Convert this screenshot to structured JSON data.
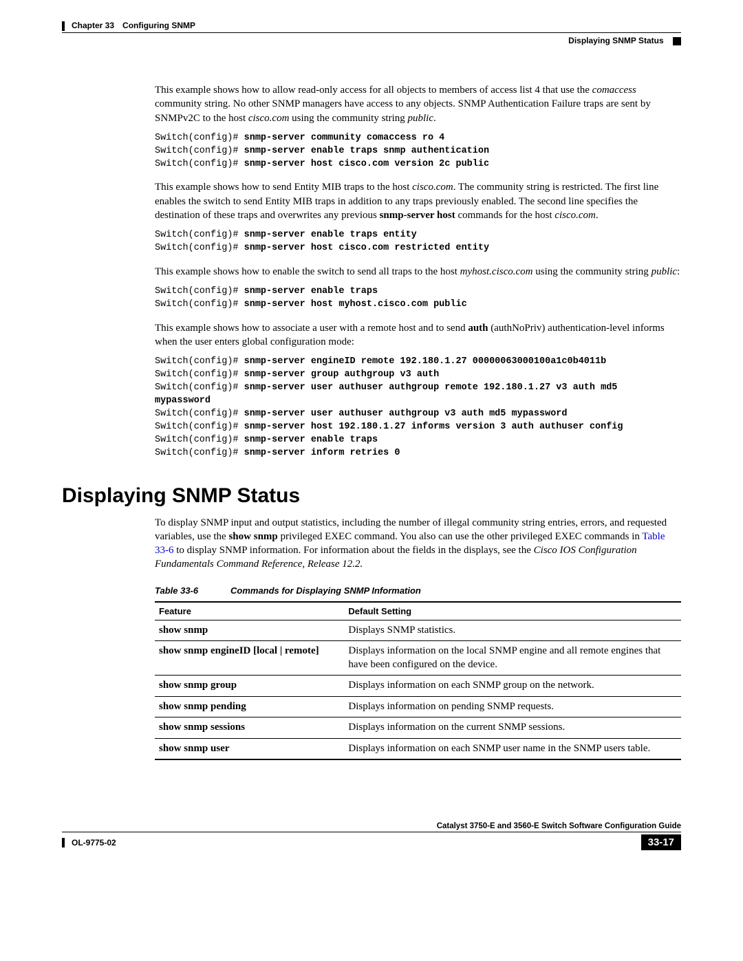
{
  "header": {
    "chapter_label": "Chapter 33",
    "chapter_title": "Configuring SNMP",
    "section_title": "Displaying SNMP Status"
  },
  "p1": {
    "t1": "This example shows how to allow read-only access for all objects to members of access list 4 that use the ",
    "i1": "comaccess",
    "t2": " community string. No other SNMP managers have access to any objects. SNMP Authentication Failure traps are sent by SNMPv2C to the host ",
    "i2": "cisco.com",
    "t3": " using the community string ",
    "i3": "public",
    "t4": "."
  },
  "code1": [
    {
      "prompt": "Switch(config)# ",
      "cmd": "snmp-server community comaccess ro 4"
    },
    {
      "prompt": "Switch(config)# ",
      "cmd": "snmp-server enable traps snmp authentication"
    },
    {
      "prompt": "Switch(config)# ",
      "cmd": "snmp-server host cisco.com version 2c public"
    }
  ],
  "p2": {
    "t1": "This example shows how to send Entity MIB traps to the host ",
    "i1": "cisco.com",
    "t2": ". The community string is restricted. The first line enables the switch to send Entity MIB traps in addition to any traps previously enabled. The second line specifies the destination of these traps and overwrites any previous ",
    "b1": "snmp-server host",
    "t3": " commands for the host ",
    "i2": "cisco.com",
    "t4": "."
  },
  "code2": [
    {
      "prompt": "Switch(config)# ",
      "cmd": "snmp-server enable traps entity"
    },
    {
      "prompt": "Switch(config)# ",
      "cmd": "snmp-server host cisco.com restricted entity"
    }
  ],
  "p3": {
    "t1": "This example shows how to enable the switch to send all traps to the host ",
    "i1": "myhost.cisco.com",
    "t2": " using the community string ",
    "i2": "public",
    "t3": ":"
  },
  "code3": [
    {
      "prompt": "Switch(config)# ",
      "cmd": "snmp-server enable traps"
    },
    {
      "prompt": "Switch(config)# ",
      "cmd": "snmp-server host myhost.cisco.com public"
    }
  ],
  "p4": {
    "t1": "This example shows how to associate a user with a remote host and to send ",
    "b1": "auth",
    "t2": " (authNoPriv) authentication-level informs when the user enters global configuration mode:"
  },
  "code4": [
    {
      "prompt": "Switch(config)# ",
      "cmd": "snmp-server engineID remote 192.180.1.27 00000063000100a1c0b4011b"
    },
    {
      "prompt": "Switch(config)# ",
      "cmd": "snmp-server group authgroup v3 auth"
    },
    {
      "prompt": "Switch(config)# ",
      "cmd": "snmp-server user authuser authgroup remote 192.180.1.27 v3 auth md5 "
    },
    {
      "prompt": "",
      "cmd": "mypassword"
    },
    {
      "prompt": "Switch(config)# ",
      "cmd": "snmp-server user authuser authgroup v3 auth md5 mypassword"
    },
    {
      "prompt": "Switch(config)# ",
      "cmd": "snmp-server host 192.180.1.27 informs version 3 auth authuser config"
    },
    {
      "prompt": "Switch(config)# ",
      "cmd": "snmp-server enable traps"
    },
    {
      "prompt": "Switch(config)# ",
      "cmd": "snmp-server inform retries 0"
    }
  ],
  "heading2": "Displaying SNMP Status",
  "p5": {
    "t1": "To display SNMP input and output statistics, including the number of illegal community string entries, errors, and requested variables, use the ",
    "b1": "show snmp",
    "t2": " privileged EXEC command. You also can use the other privileged EXEC commands in ",
    "link": "Table 33-6",
    "t3": " to display SNMP information. For information about the fields in the displays, see the ",
    "i1": "Cisco IOS Configuration Fundamentals Command Reference, Release 12.2."
  },
  "table": {
    "label": "Table 33-6",
    "caption": "Commands for Displaying SNMP Information",
    "headers": [
      "Feature",
      "Default Setting"
    ],
    "rows": [
      {
        "feature": "show snmp",
        "desc": "Displays SNMP statistics."
      },
      {
        "feature": "show snmp engineID [local | remote]",
        "desc": "Displays information on the local SNMP engine and all remote engines that have been configured on the device."
      },
      {
        "feature": "show snmp group",
        "desc": "Displays information on each SNMP group on the network."
      },
      {
        "feature": "show snmp pending",
        "desc": "Displays information on pending SNMP requests."
      },
      {
        "feature": "show snmp sessions",
        "desc": "Displays information on the current SNMP sessions."
      },
      {
        "feature": "show snmp user",
        "desc": "Displays information on each SNMP user name in the SNMP users table."
      }
    ]
  },
  "footer": {
    "guide_title": "Catalyst 3750-E and 3560-E Switch Software Configuration Guide",
    "doc_id": "OL-9775-02",
    "page_num": "33-17"
  }
}
